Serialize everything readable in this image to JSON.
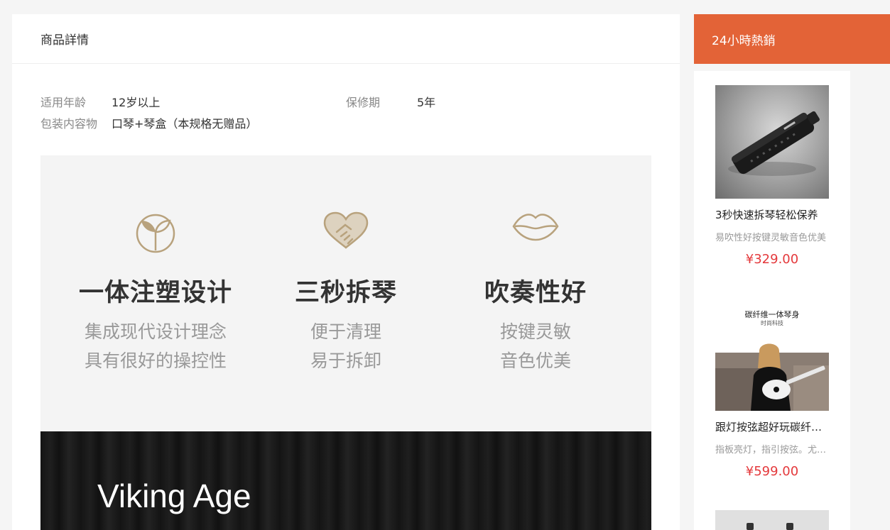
{
  "detail": {
    "title": "商品詳情",
    "specs": [
      {
        "label": "适用年龄",
        "value": "12岁以上"
      },
      {
        "label": "保修期",
        "value": "5年"
      },
      {
        "label": "包装内容物",
        "value": "口琴+琴盒（本规格无赠品）"
      }
    ],
    "features": [
      {
        "icon": "sprout-icon",
        "title": "一体注塑设计",
        "desc": [
          "集成现代设计理念",
          "具有很好的操控性"
        ]
      },
      {
        "icon": "heart-handshake-icon",
        "title": "三秒拆琴",
        "desc": [
          "便于清理",
          "易于拆卸"
        ]
      },
      {
        "icon": "lips-icon",
        "title": "吹奏性好",
        "desc": [
          "按键灵敏",
          "音色优美"
        ]
      }
    ],
    "banner_text": "Viking Age",
    "icon_color": "#b8a27d"
  },
  "hot": {
    "title": "24小時熱銷",
    "accent_color": "#e36337",
    "price_color": "#e4393c",
    "items": [
      {
        "name": "3秒快速拆琴轻松保养",
        "desc": "易吹性好按键灵敏音色优美",
        "price": "¥329.00",
        "image": "harmonica-photo"
      },
      {
        "name": "跟灯按弦超好玩碳纤维尤克里里",
        "desc": "指板亮灯，指引按弦。尤克里里",
        "price": "¥599.00",
        "image": "ukulele-photo",
        "image_caption": "碳纤维一体琴身",
        "image_subcaption": "时尚科技"
      }
    ]
  }
}
